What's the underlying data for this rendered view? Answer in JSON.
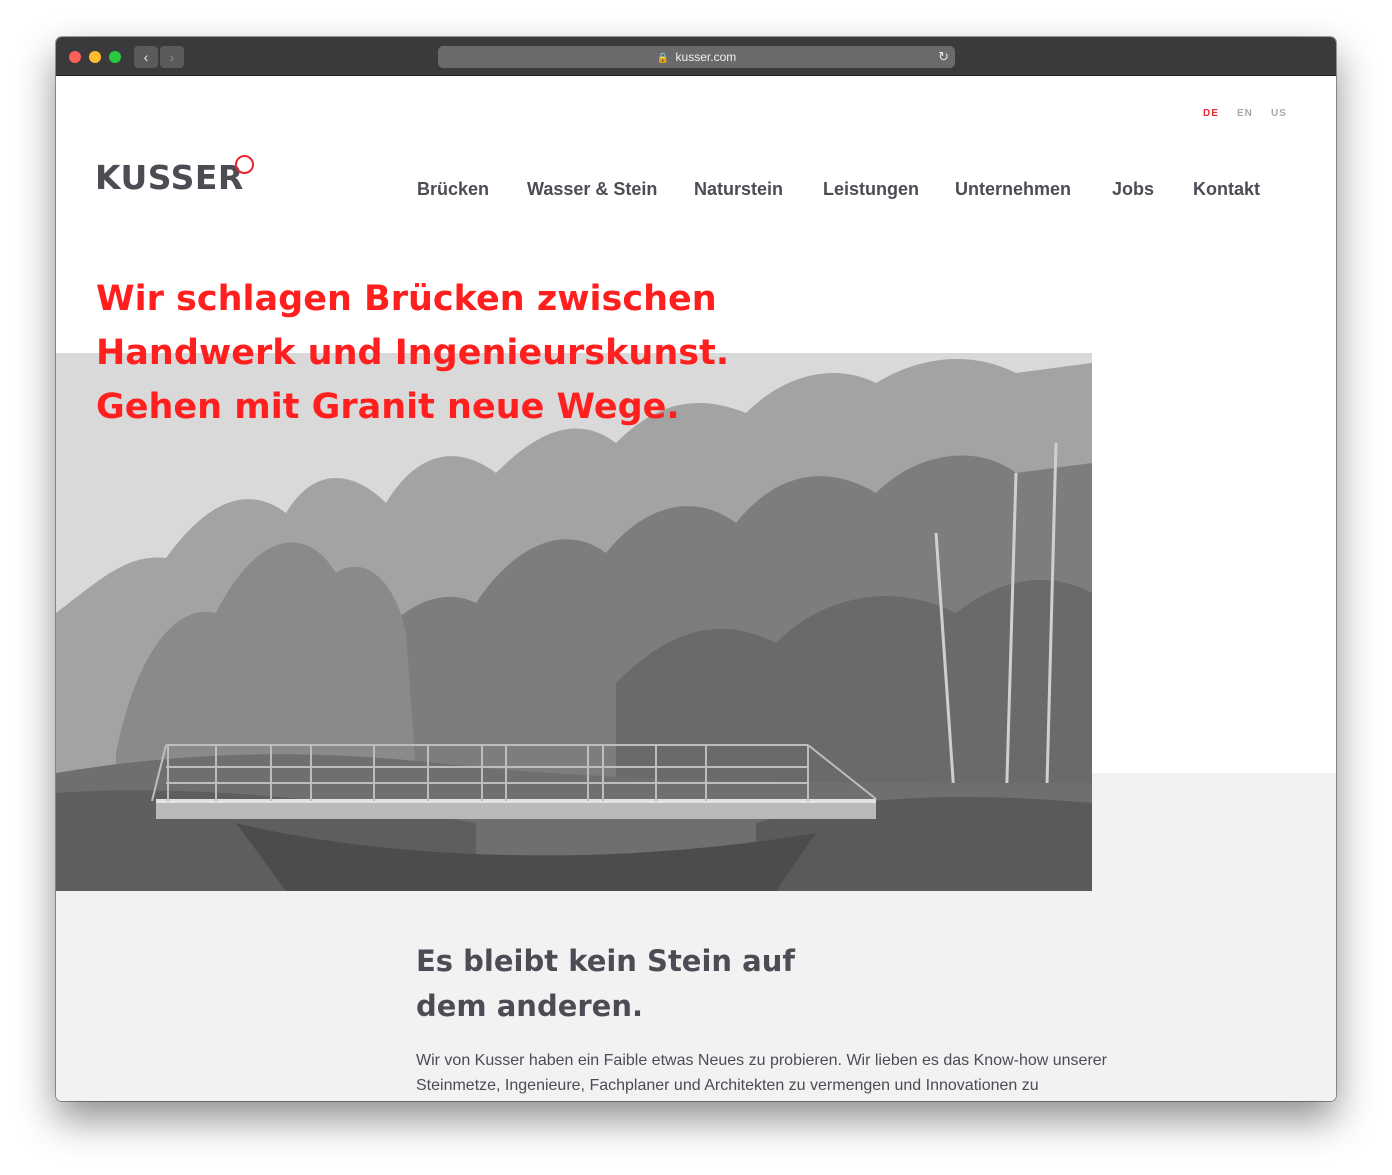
{
  "browser": {
    "url": "kusser.com",
    "back_glyph": "‹",
    "forward_glyph": "›",
    "lock_glyph": "🔒",
    "reload_glyph": "↻"
  },
  "site": {
    "languages": [
      "DE",
      "EN",
      "US"
    ],
    "active_language": "DE",
    "logo": "KUSSER",
    "nav": [
      "Brücken",
      "Wasser & Stein",
      "Naturstein",
      "Leistungen",
      "Unternehmen",
      "Jobs",
      "Kontakt"
    ],
    "hero": {
      "lines": [
        "Wir schlagen Brücken zwischen",
        "Handwerk und Ingenieurskunst.",
        "Gehen mit Granit neue Wege."
      ]
    },
    "section": {
      "title_lines": [
        "Es bleibt kein Stein auf",
        "dem anderen."
      ],
      "body_lines": [
        "Wir von Kusser haben ein Faible etwas Neues zu probieren. Wir lieben es das Know-how unserer",
        "Steinmetze, Ingenieure, Fachplaner und Architekten zu vermengen und Innovationen zu"
      ]
    }
  },
  "colors": {
    "accent": "#ff1f1f",
    "text": "#4b4c54",
    "muted": "#a8a8ad",
    "section_bg": "#f2f2f3"
  }
}
